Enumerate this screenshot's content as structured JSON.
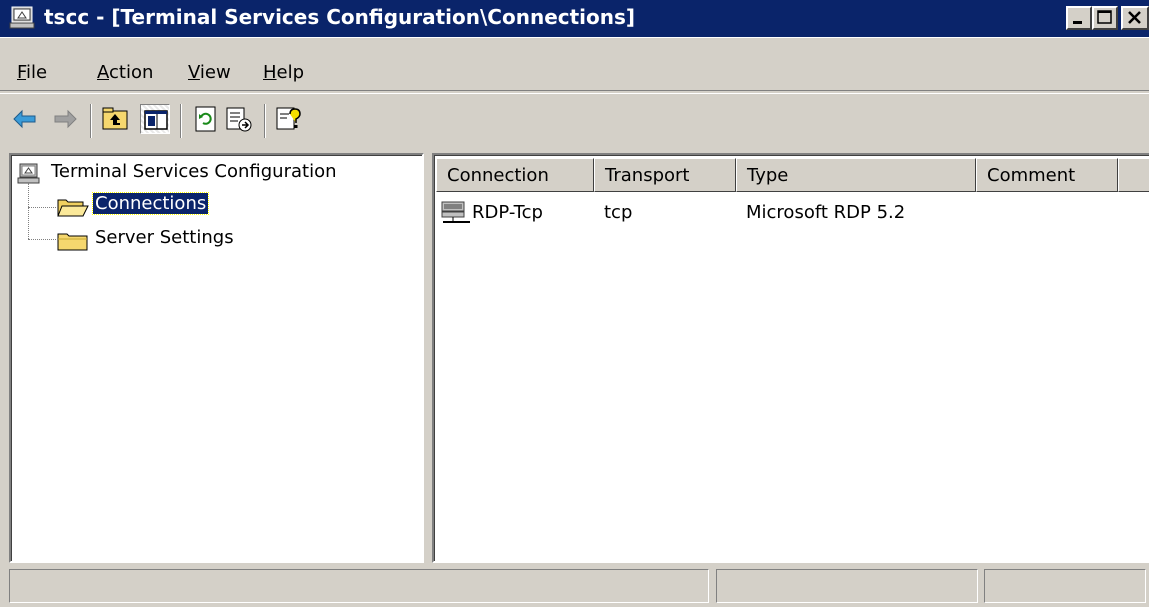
{
  "window": {
    "title": "tscc - [Terminal Services Configuration\\Connections]",
    "colors": {
      "titlebar": "#0a246a",
      "face": "#d4d0c8",
      "selection": "#0a246a"
    }
  },
  "menu": {
    "items": [
      {
        "label": "File",
        "mnemonic": "F",
        "rest": "ile"
      },
      {
        "label": "Action",
        "mnemonic": "A",
        "rest": "ction"
      },
      {
        "label": "View",
        "mnemonic": "V",
        "rest": "iew"
      },
      {
        "label": "Help",
        "mnemonic": "H",
        "rest": "elp"
      }
    ]
  },
  "toolbar": {
    "icons": [
      "back-arrow-icon",
      "forward-arrow-icon",
      "up-folder-icon",
      "show-hide-tree-icon",
      "refresh-icon",
      "export-list-icon",
      "help-icon"
    ]
  },
  "tree": {
    "root": {
      "label": "Terminal Services Configuration",
      "icon": "computer-icon"
    },
    "children": [
      {
        "label": "Connections",
        "icon": "open-folder-icon",
        "selected": true
      },
      {
        "label": "Server Settings",
        "icon": "folder-icon",
        "selected": false
      }
    ]
  },
  "list": {
    "columns": [
      "Connection",
      "Transport",
      "Type",
      "Comment"
    ],
    "rows": [
      {
        "connection": "RDP-Tcp",
        "transport": "tcp",
        "type": "Microsoft RDP 5.2",
        "comment": "",
        "icon": "network-connection-icon"
      }
    ]
  },
  "statusbar": {
    "panels": [
      "",
      "",
      ""
    ]
  }
}
